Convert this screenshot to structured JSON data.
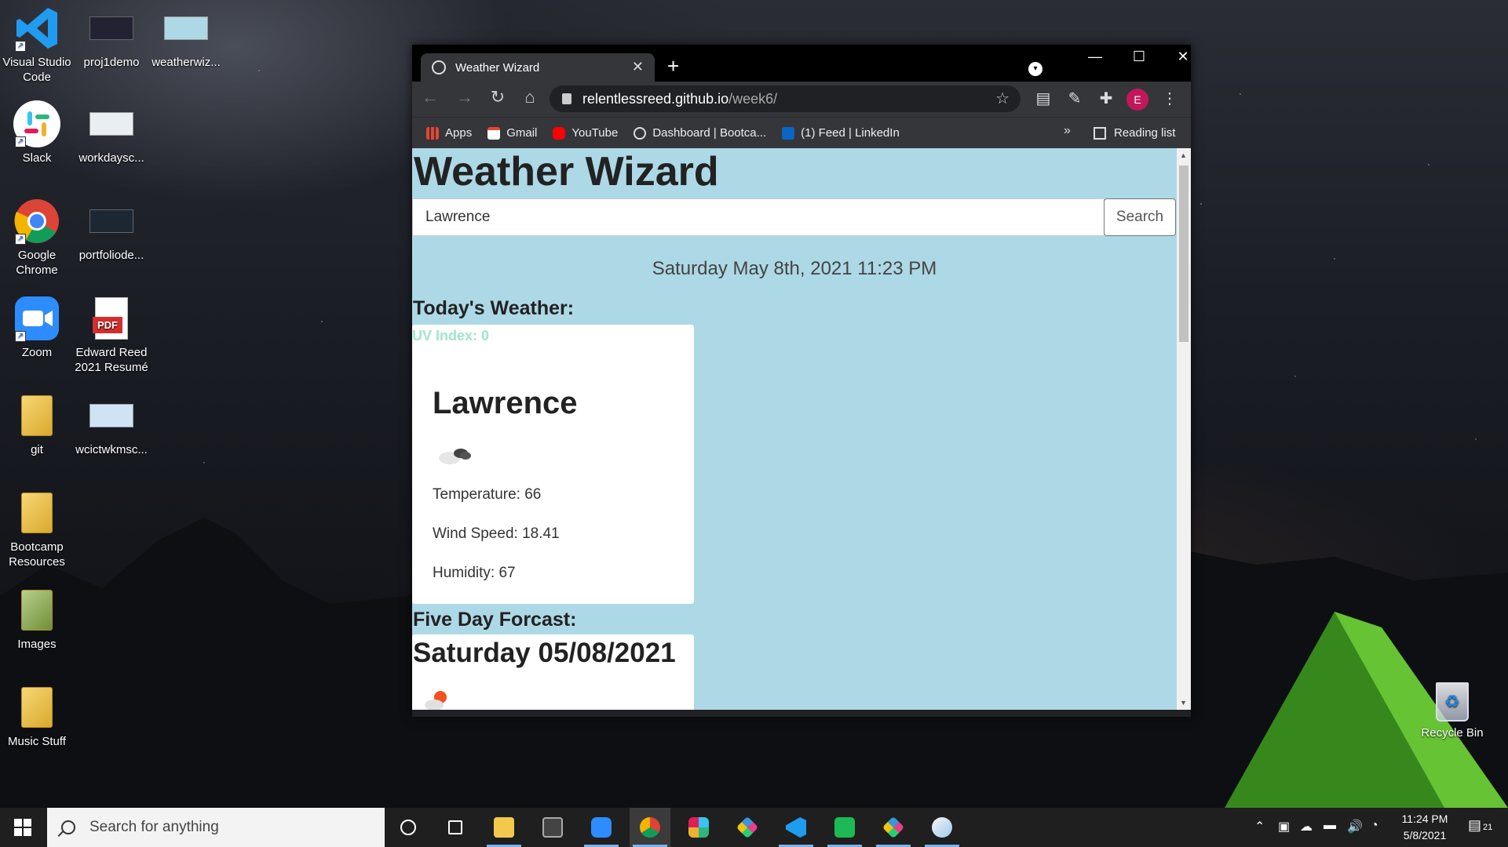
{
  "desktop": {
    "icons_left": [
      {
        "label": "Visual Studio Code",
        "icon": "vscode-icon"
      },
      {
        "label": "Slack",
        "icon": "slack-icon"
      },
      {
        "label": "Google Chrome",
        "icon": "chrome-icon"
      },
      {
        "label": "Zoom",
        "icon": "zoom-icon"
      },
      {
        "label": "git",
        "icon": "folder-icon"
      },
      {
        "label": "Bootcamp Resources",
        "icon": "folder-icon"
      },
      {
        "label": "Images",
        "icon": "folder-icon"
      },
      {
        "label": "Music Stuff",
        "icon": "folder-icon"
      }
    ],
    "icons_right": [
      {
        "label": "proj1demo",
        "icon": "video-thumbnail-icon"
      },
      {
        "label": "workdaysc...",
        "icon": "image-thumbnail-icon"
      },
      {
        "label": "portfoliode...",
        "icon": "video-thumbnail-icon"
      },
      {
        "label": "Edward Reed 2021 Resumé",
        "icon": "pdf-icon",
        "badge": "PDF"
      },
      {
        "label": "wcictwkmsc...",
        "icon": "image-thumbnail-icon"
      }
    ],
    "icon_col3": {
      "label": "weatherwiz...",
      "icon": "image-thumbnail-icon"
    },
    "recycle_bin": {
      "label": "Recycle Bin",
      "icon": "recycle-bin-icon"
    }
  },
  "browser": {
    "tab_title": "Weather Wizard",
    "tab_close": "✕",
    "new_tab": "+",
    "url_host": "relentlessreed.github.io",
    "url_path": "/week6/",
    "avatar_letter": "E",
    "bookmarks": [
      {
        "label": "Apps",
        "icon": "apps-grid-icon",
        "color": "#ea4335"
      },
      {
        "label": "Gmail",
        "icon": "gmail-icon",
        "color": "#ea4335"
      },
      {
        "label": "YouTube",
        "icon": "youtube-icon",
        "color": "#ff0000"
      },
      {
        "label": "Dashboard | Bootca...",
        "icon": "globe-icon",
        "color": "#dddddd"
      },
      {
        "label": "(1) Feed | LinkedIn",
        "icon": "linkedin-icon",
        "color": "#0a66c2"
      }
    ],
    "bookmarks_more": "»",
    "reading_list": "Reading list"
  },
  "page": {
    "title": "Weather Wizard",
    "search_value": "Lawrence",
    "search_button": "Search",
    "datetime": "Saturday May 8th, 2021 11:23 PM",
    "today_heading": "Today's Weather:",
    "uv_index": "UV Index: 0",
    "city": "Lawrence",
    "temperature": "Temperature: 66",
    "wind_speed": "Wind Speed: 18.41",
    "humidity": "Humidity: 67",
    "forecast_heading": "Five Day Forcast:",
    "forecast_date": "Saturday 05/08/2021",
    "background_color": "#add8e6",
    "uv_color": "#9fe7c9"
  },
  "taskbar": {
    "search_placeholder": "Search for anything",
    "time": "11:24 PM",
    "date": "5/8/2021",
    "notifications": "21",
    "apps": [
      "cortana-icon",
      "task-view-icon",
      "file-explorer-icon",
      "store-icon",
      "zoom-icon",
      "chrome-icon",
      "slack-icon",
      "gitkraken-icon",
      "vscode-icon",
      "spotify-icon",
      "gitkraken-icon",
      "paint-icon"
    ]
  }
}
